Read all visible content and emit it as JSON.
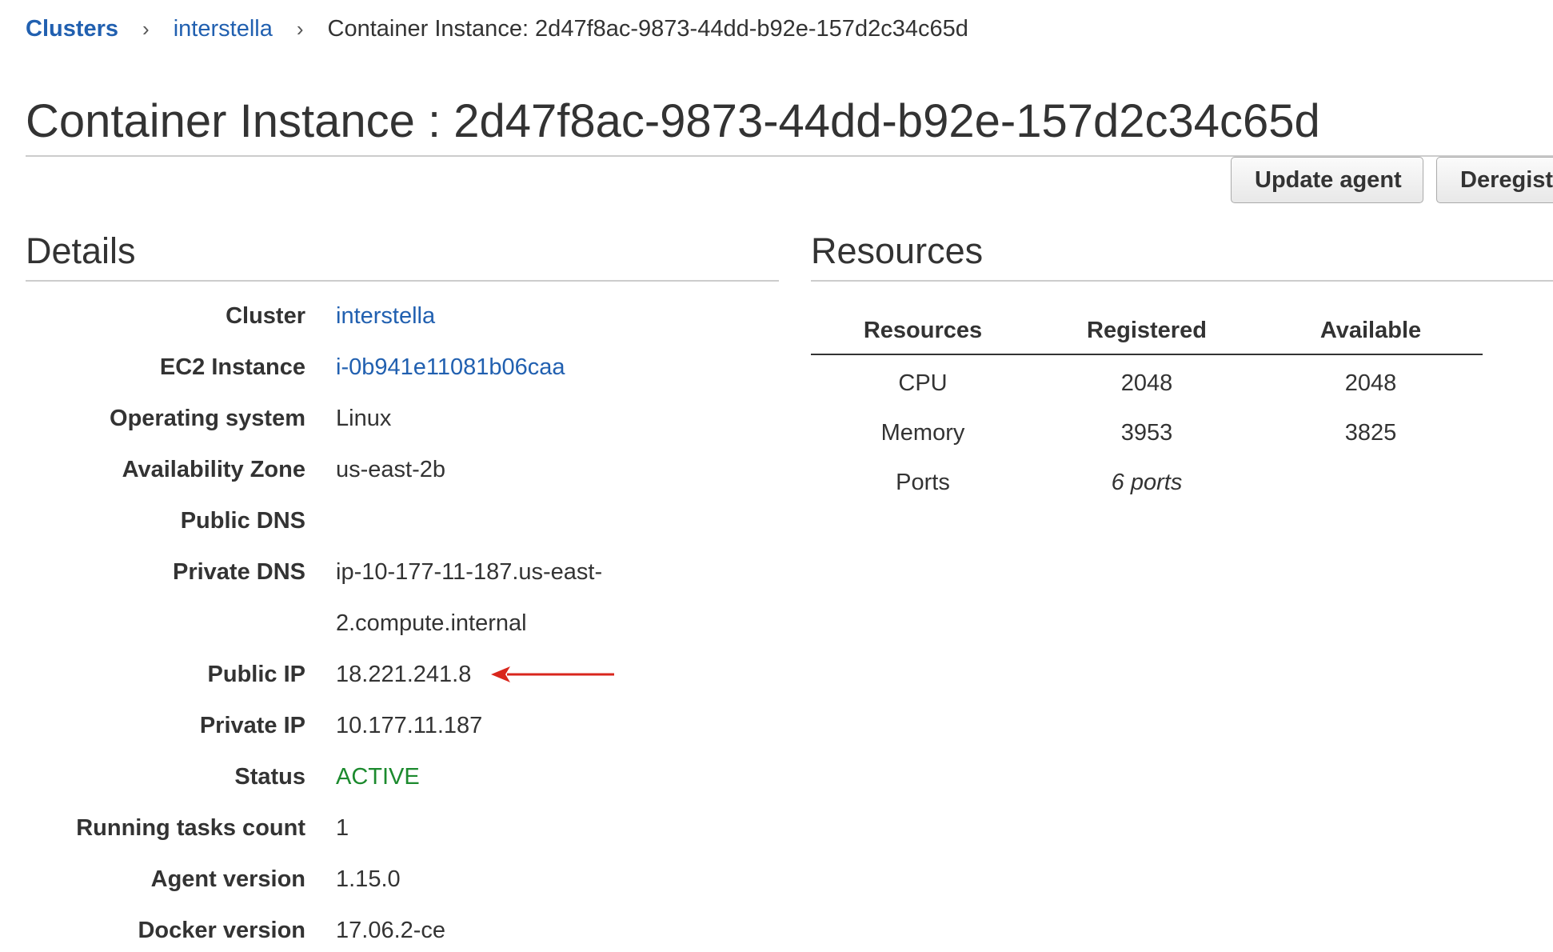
{
  "breadcrumb": {
    "clusters": "Clusters",
    "cluster_name": "interstella",
    "current": "Container Instance: 2d47f8ac-9873-44dd-b92e-157d2c34c65d",
    "separator": "›"
  },
  "page_title": "Container Instance : 2d47f8ac-9873-44dd-b92e-157d2c34c65d",
  "toolbar": {
    "update_agent_label": "Update agent",
    "deregister_label": "Deregiste"
  },
  "details": {
    "title": "Details",
    "cluster_label": "Cluster",
    "cluster_value": "interstella",
    "ec2_label": "EC2 Instance",
    "ec2_value": "i-0b941e11081b06caa",
    "os_label": "Operating system",
    "os_value": "Linux",
    "az_label": "Availability Zone",
    "az_value": "us-east-2b",
    "public_dns_label": "Public DNS",
    "public_dns_value": "",
    "private_dns_label": "Private DNS",
    "private_dns_line1": "ip-10-177-11-187.us-east-",
    "private_dns_line2": "2.compute.internal",
    "public_ip_label": "Public IP",
    "public_ip_value": "18.221.241.8",
    "private_ip_label": "Private IP",
    "private_ip_value": "10.177.11.187",
    "status_label": "Status",
    "status_value": "ACTIVE",
    "running_tasks_label": "Running tasks count",
    "running_tasks_value": "1",
    "agent_version_label": "Agent version",
    "agent_version_value": "1.15.0",
    "docker_version_label": "Docker version",
    "docker_version_value": "17.06.2-ce"
  },
  "resources": {
    "title": "Resources",
    "headers": [
      "Resources",
      "Registered",
      "Available"
    ],
    "rows": [
      [
        "CPU",
        "2048",
        "2048"
      ],
      [
        "Memory",
        "3953",
        "3825"
      ],
      [
        "Ports",
        "6 ports",
        ""
      ]
    ]
  },
  "colors": {
    "link": "#2160b0",
    "status_active": "#1c8a2e",
    "annotation_arrow": "#d9261c"
  },
  "icons": {
    "breadcrumb_separator": "chevron-right-icon",
    "annotation": "red-arrow-left-icon"
  }
}
